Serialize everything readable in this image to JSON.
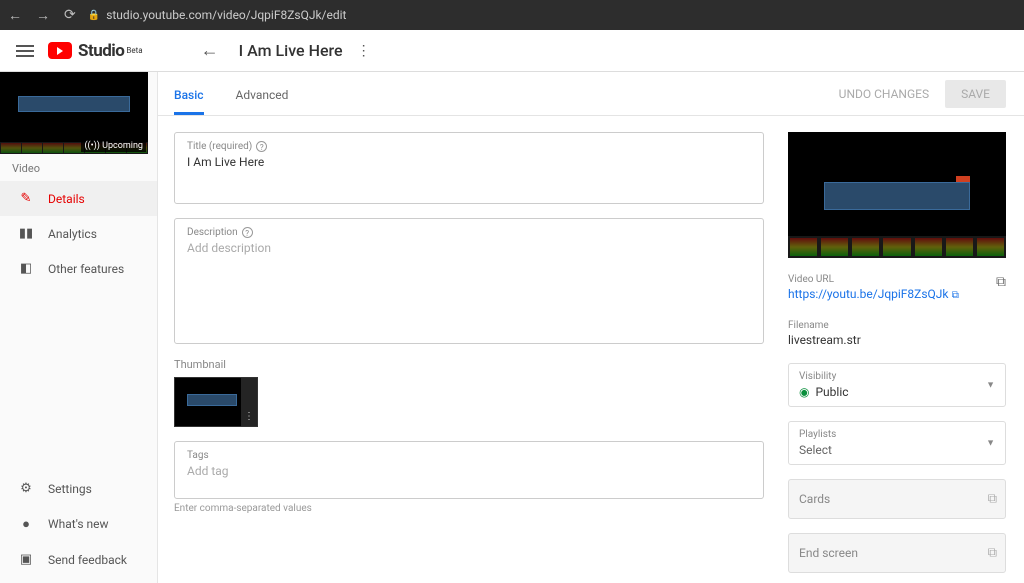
{
  "browser": {
    "url": "studio.youtube.com/video/JqpiF8ZsQJk/edit"
  },
  "header": {
    "brand_studio": "Studio",
    "brand_beta": "Beta",
    "page_title": "I Am Live Here"
  },
  "sidebar": {
    "thumb_badge": "((•)) Upcoming",
    "video_label": "Video",
    "items": [
      {
        "icon": "✎",
        "label": "Details",
        "active": true,
        "name": "details"
      },
      {
        "icon": "▮▮",
        "label": "Analytics",
        "active": false,
        "name": "analytics"
      },
      {
        "icon": "◧",
        "label": "Other features",
        "active": false,
        "name": "other-features"
      }
    ],
    "footer": [
      {
        "icon": "⚙",
        "label": "Settings",
        "name": "settings"
      },
      {
        "icon": "●",
        "label": "What's new",
        "name": "whats-new"
      },
      {
        "icon": "▣",
        "label": "Send feedback",
        "name": "send-feedback"
      }
    ]
  },
  "toolbar": {
    "tabs": {
      "basic": "Basic",
      "advanced": "Advanced"
    },
    "undo": "UNDO CHANGES",
    "save": "SAVE"
  },
  "form": {
    "title_label": "Title (required)",
    "title_value": "I  Am Live Here",
    "desc_label": "Description",
    "desc_placeholder": "Add description",
    "thumbnail_label": "Thumbnail",
    "tags_label": "Tags",
    "tags_placeholder": "Add tag",
    "tags_hint": "Enter comma-separated values"
  },
  "side": {
    "video_url_label": "Video URL",
    "video_url": "https://youtu.be/JqpiF8ZsQJk",
    "filename_label": "Filename",
    "filename": "livestream.str",
    "visibility_label": "Visibility",
    "visibility_value": "Public",
    "playlists_label": "Playlists",
    "playlists_value": "Select",
    "cards": "Cards",
    "end_screen": "End screen"
  }
}
